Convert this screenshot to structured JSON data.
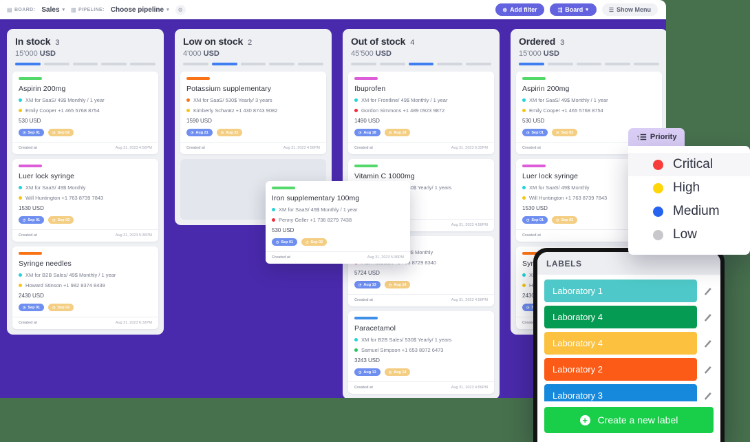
{
  "topbar": {
    "board_chip": "BOARD:",
    "board_icon": "grid-icon",
    "board_value": "Sales",
    "pipeline_chip": "PIPELINE:",
    "pipeline_icon": "columns-icon",
    "pipeline_value": "Choose pipeline",
    "gear_icon": "gear-icon",
    "caret_icon": "chevron-down-icon",
    "add_filter": "Add filter",
    "add_filter_icon": "filter-icon",
    "board_button": "Board",
    "board_button_icon": "board-icon",
    "show_menu": "Show Menu",
    "show_menu_icon": "menu-icon"
  },
  "colors": {
    "board_purple": "#4a2aac",
    "page_green": "#47704d",
    "accent_blue": "#3f7ef0",
    "button_purple": "#6363e0",
    "create_green": "#19cf4a"
  },
  "columns": [
    {
      "name": "In stock",
      "count": "3",
      "sum_value": "15'000",
      "sum_currency": "USD",
      "active_segment": 0,
      "segments": 5,
      "cards": [
        {
          "bar_color": "#53d86a",
          "title": "Aspirin 200mg",
          "plan_dot": "#22d3d8",
          "plan": "XM for SaaS/ 49$ Monthly / 1 year",
          "person_dot": "#f5c518",
          "person": "Emily Cooper +1 465 5768 8754",
          "amount": "530 USD",
          "pill1": "Sep 01",
          "pill2": "Sep 02",
          "foot_label": "Created at",
          "foot_date": "Aug 31, 2023 4:56PM"
        },
        {
          "bar_color": "#dd5cd8",
          "title": "Luer lock syringe",
          "plan_dot": "#22d3d8",
          "plan": "XM for SaaS/ 49$ Monthly",
          "person_dot": "#f5c518",
          "person": "Will Huntington +1 763 8739 7843",
          "amount": "1530 USD",
          "pill1": "Sep 01",
          "pill2": "Sep 02",
          "foot_label": "Created at",
          "foot_date": "Aug 31, 2023 5:36PM"
        },
        {
          "bar_color": "#f97316",
          "title": "Syringe needles",
          "plan_dot": "#22d3d8",
          "plan": "XM for B2B Sales/ 49$ Monthly / 1 year",
          "person_dot": "#f5c518",
          "person": "Howard Stinson +1 982 8374 8439",
          "amount": "2430 USD",
          "pill1": "Sep 01",
          "pill2": "Sep 02",
          "foot_label": "Created at",
          "foot_date": "Aug 31, 2023 6:32PM"
        }
      ]
    },
    {
      "name": "Low on stock",
      "count": "2",
      "sum_value": "4'000",
      "sum_currency": "USD",
      "active_segment": 1,
      "segments": 5,
      "cards": [
        {
          "bar_color": "#f97316",
          "title": "Potassium supplementary",
          "plan_dot": "#f97316",
          "plan": "XM for SaaS/ 530$ Yearly/ 3 years",
          "person_dot": "#f5c518",
          "person": "Kimberly Schwatz +1 430 8743 9082",
          "amount": "1590 USD",
          "pill1": "Aug 21",
          "pill2": "Aug 22",
          "foot_label": "Created at",
          "foot_date": "Aug 31, 2023 4:56PM"
        }
      ]
    },
    {
      "name": "Out of stock",
      "count": "4",
      "sum_value": "45'500",
      "sum_currency": "USD",
      "active_segment": 2,
      "segments": 5,
      "cards": [
        {
          "bar_color": "#dd5cd8",
          "title": "Ibuprofen",
          "plan_dot": "#22d3d8",
          "plan": "XM for Frontline/ 49$ Monthly / 1 year",
          "person_dot": "#ef2d3c",
          "person": "Gordon Simmons +1 489 0923 9872",
          "amount": "1490 USD",
          "pill1": "Aug 18",
          "pill2": "Aug 19",
          "foot_label": "Created at",
          "foot_date": "Aug 31, 2023 6:32PM"
        },
        {
          "bar_color": "#53d86a",
          "title": "Vitamin C 1000mg",
          "plan_dot": "#22d3d8",
          "plan": "XM for B2B Sales/ 530$ Yearly/ 1 years",
          "person_dot": "#f5c518",
          "person": "974 2378",
          "amount": "",
          "pill1": "",
          "pill2": "",
          "foot_label": "",
          "foot_date": "Aug 31, 2023 4:56PM"
        },
        {
          "bar_color": "#53d86a",
          "title": "",
          "plan_dot": "#22c55e",
          "plan": "XM for B2B Sales/ 49$ Monthly",
          "person_dot": "#ef2d3c",
          "person": "Pam Nicolson +1 763 8729 8340",
          "amount": "5724 USD",
          "pill1": "Aug 13",
          "pill2": "Aug 14",
          "foot_label": "Created at",
          "foot_date": "Aug 31, 2023 4:56PM"
        },
        {
          "bar_color": "#3f8fe8",
          "title": "Paracetamol",
          "plan_dot": "#22d3d8",
          "plan": "XM for B2B Sales/ 530$ Yearly/ 1 years",
          "person_dot": "#22c55e",
          "person": "Samuel Simpson +1 653 8972 6473",
          "amount": "3243 USD",
          "pill1": "Aug 13",
          "pill2": "Aug 14",
          "foot_label": "Created at",
          "foot_date": "Aug 31, 2023 4:56PM"
        }
      ]
    },
    {
      "name": "Ordered",
      "count": "3",
      "sum_value": "15'000",
      "sum_currency": "USD",
      "active_segment": 0,
      "segments": 5,
      "cards": [
        {
          "bar_color": "#53d86a",
          "title": "Aspirin 200mg",
          "plan_dot": "#22d3d8",
          "plan": "XM for SaaS/ 49$ Monthly / 1 year",
          "person_dot": "#f5c518",
          "person": "Emily Cooper +1 465 5768 8754",
          "amount": "530 USD",
          "pill1": "Sep 01",
          "pill2": "Sep 02",
          "foot_label": "Created at",
          "foot_date": "Aug 3"
        },
        {
          "bar_color": "#dd5cd8",
          "title": "Luer lock syringe",
          "plan_dot": "#22d3d8",
          "plan": "XM for SaaS/ 49$ Monthly",
          "person_dot": "#f5c518",
          "person": "Will Huntington +1 763 8739 7843",
          "amount": "1530 USD",
          "pill1": "Sep 01",
          "pill2": "Sep 02",
          "foot_label": "Created at",
          "foot_date": "Aug 3"
        },
        {
          "bar_color": "#f97316",
          "title": "Syringe needles",
          "plan_dot": "#22d3d8",
          "plan": "XM for B2B Sales/ 49$ Monthly",
          "person_dot": "#f5c518",
          "person": "Howard Stinson +1 982 8374 8439",
          "amount": "2430 USD",
          "pill1": "Sep 01",
          "pill2": "Sep 02",
          "foot_label": "Created at",
          "foot_date": "Aug 3"
        }
      ]
    }
  ],
  "drag_card": {
    "bar_color": "#53d86a",
    "title": "Iron supplementary 100mg",
    "plan_dot": "#22d3d8",
    "plan": "XM for SaaS/ 49$ Monthly / 1 year",
    "person_dot": "#ef2d3c",
    "person": "Penny Geller +1 736 8279 7438",
    "amount": "530 USD",
    "pill1": "Sep 01",
    "pill2": "Sep 02",
    "foot_label": "Created at",
    "foot_date": "Aug 31, 2023 5:36PM"
  },
  "priority": {
    "tab_label": "Priority",
    "tab_icon": "sort-icon",
    "items": [
      {
        "label": "Critical",
        "color": "#f83b3b",
        "selected": true
      },
      {
        "label": "High",
        "color": "#ffd60a",
        "selected": false
      },
      {
        "label": "Medium",
        "color": "#2563f0",
        "selected": false
      },
      {
        "label": "Low",
        "color": "#c7c7cc",
        "selected": false
      }
    ]
  },
  "labels_panel": {
    "title": "LABELS",
    "edit_icon": "pencil-icon",
    "items": [
      {
        "label": "Laboratory 1",
        "color": "#4ec8c8"
      },
      {
        "label": "Laboratory 4",
        "color": "#059b52"
      },
      {
        "label": "Laboratory 4",
        "color": "#fcc13f"
      },
      {
        "label": "Laboratory 2",
        "color": "#fb5a17"
      },
      {
        "label": "Laboratory 3",
        "color": "#1789dd"
      }
    ],
    "create_label": "Create a new label",
    "create_icon": "plus-circle-icon"
  }
}
